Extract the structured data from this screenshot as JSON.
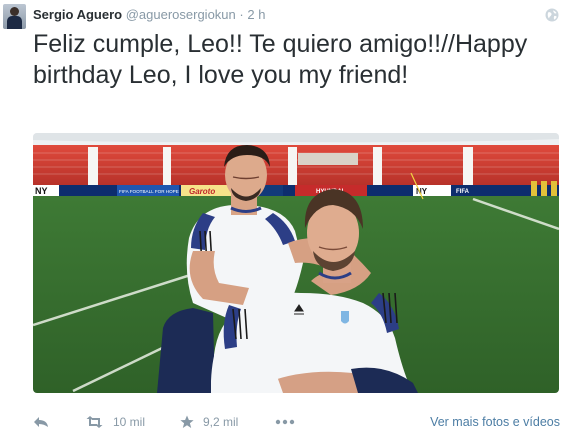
{
  "author": {
    "name": "Sergio Aguero",
    "handle": "@aguerosergiokun",
    "separator": "·",
    "time": "2 h"
  },
  "tweet": {
    "text": "Feliz cumple, Leo!! Te quiero amigo!!//Happy birthday Leo, I love you my friend!"
  },
  "photo": {
    "stadium_boards": [
      "NY",
      "FIFA FOOTBALL FOR HOPE",
      "Garoto",
      "NY",
      "HYUNDAI",
      "FIFA"
    ],
    "jersey_brand": "adidas"
  },
  "actions": {
    "retweets": "10 mil",
    "favorites": "9,2 mil",
    "more_photos_link": "Ver mais fotos e vídeos"
  },
  "icons": [
    "avatar",
    "globe-icon",
    "reply-icon",
    "retweet-icon",
    "star-icon",
    "more-icon"
  ],
  "colors": {
    "text": "#292f33",
    "muted": "#8899a6",
    "link": "#4c7da4"
  }
}
